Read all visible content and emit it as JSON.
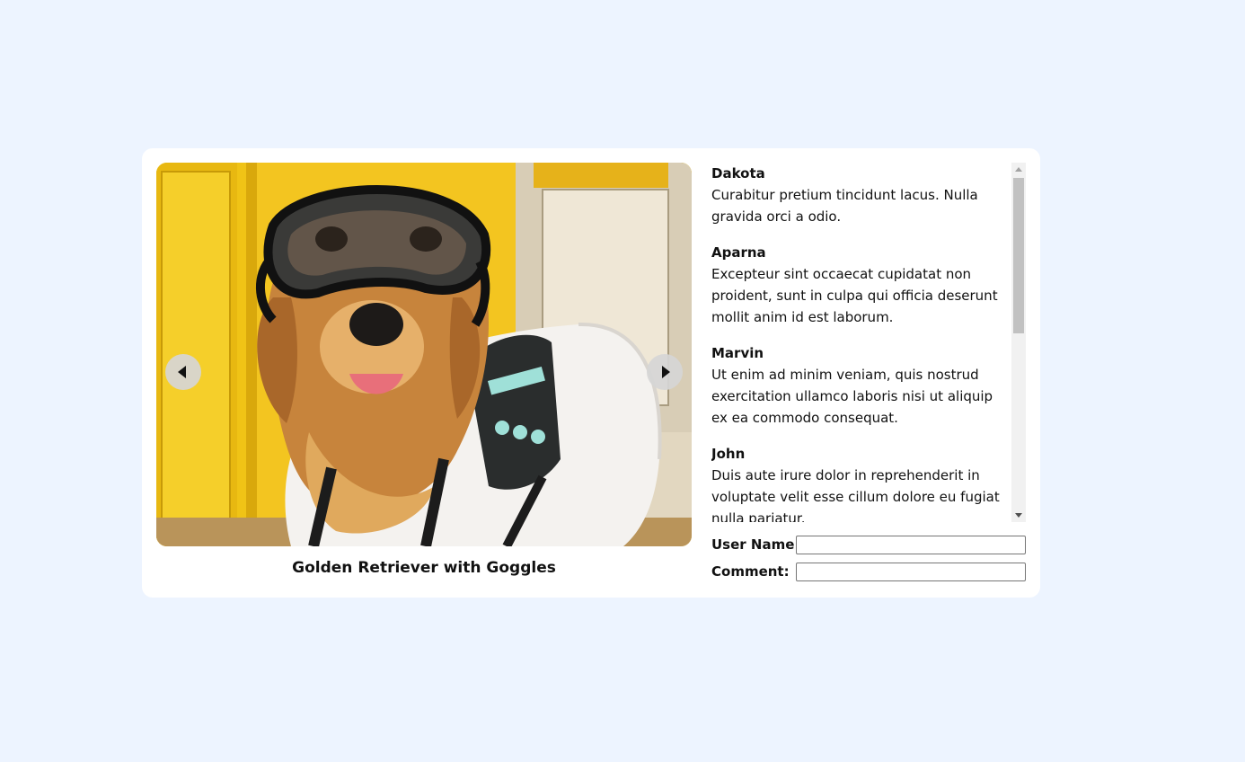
{
  "gallery": {
    "image_alt": "Golden Retriever with Goggles",
    "caption": "Golden Retriever with Goggles",
    "prev_icon": "triangle-left",
    "next_icon": "triangle-right"
  },
  "comments": [
    {
      "name": "Dakota",
      "text": "Curabitur pretium tincidunt lacus. Nulla gravida orci a odio."
    },
    {
      "name": "Aparna",
      "text": "Excepteur sint occaecat cupidatat non proident, sunt in culpa qui officia deserunt mollit anim id est laborum."
    },
    {
      "name": "Marvin",
      "text": "Ut enim ad minim veniam, quis nostrud exercitation ullamco laboris nisi ut aliquip ex ea commodo consequat."
    },
    {
      "name": "John",
      "text": "Duis aute irure dolor in reprehenderit in voluptate velit esse cillum dolore eu fugiat nulla pariatur."
    }
  ],
  "form": {
    "username_label": "User Name:",
    "username_value": "",
    "comment_label": "Comment:",
    "comment_value": ""
  },
  "colors": {
    "page_bg": "#edf4ff",
    "card_bg": "#ffffff"
  }
}
